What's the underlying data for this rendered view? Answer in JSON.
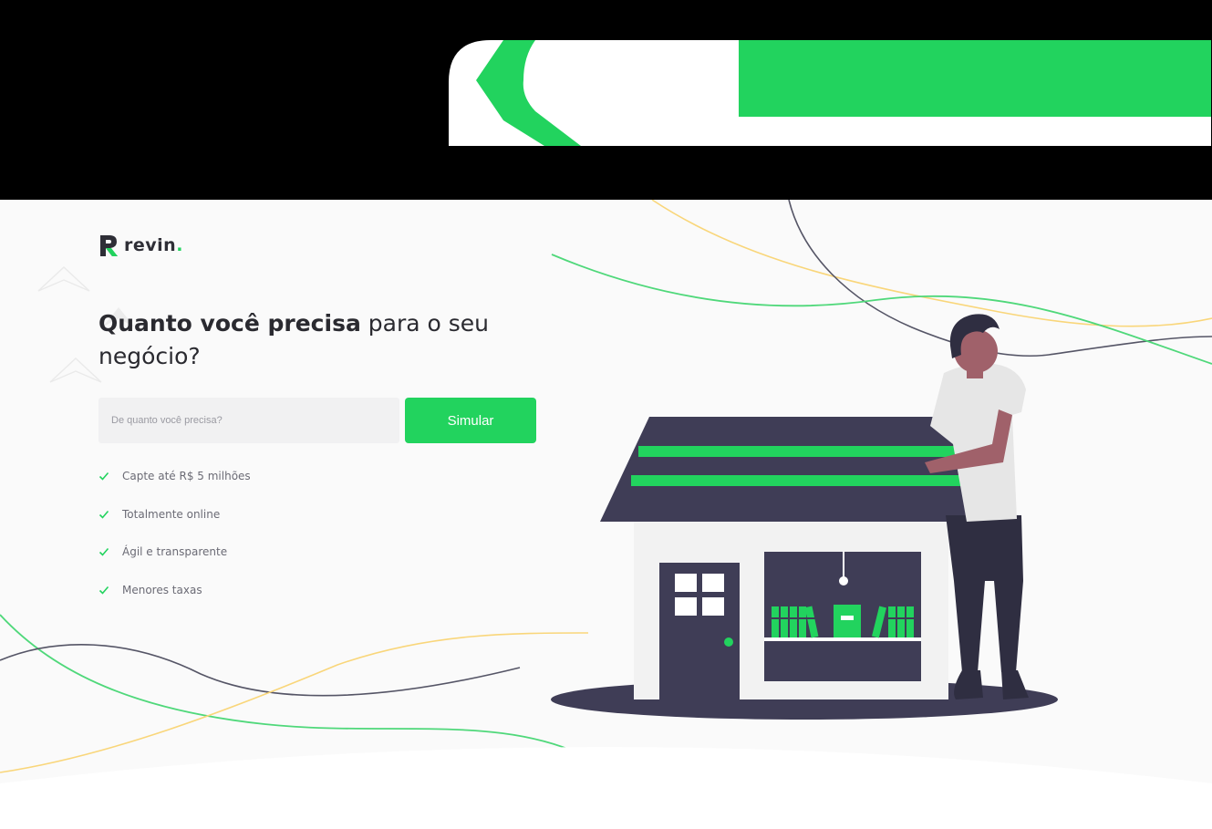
{
  "brand": {
    "name": "revin",
    "dot": ".",
    "accent_color": "#22d35e",
    "dark_color": "#2e2e36"
  },
  "hero": {
    "headline_bold": "Quanto você precisa",
    "headline_regular": " para o seu negócio?",
    "input_placeholder": "De quanto você precisa?",
    "button_label": "Simular"
  },
  "features": [
    {
      "label": "Capte até R$ 5 milhões",
      "icon": "check-icon"
    },
    {
      "label": "Totalmente online",
      "icon": "check-icon"
    },
    {
      "label": "Ágil e transparente",
      "icon": "check-icon"
    },
    {
      "label": "Menores taxas",
      "icon": "check-icon"
    }
  ],
  "colors": {
    "background": "#fafafa",
    "illustration_dark": "#3f3d56",
    "curve_yellow": "#f9d67a",
    "curve_gray": "#555566"
  },
  "icons": {
    "banner_arrow": "chevron-left-icon",
    "logo_mark": "revin-logo-icon",
    "feature_bullet": "check-icon",
    "decor_chevrons": "chevron-up-icon"
  }
}
